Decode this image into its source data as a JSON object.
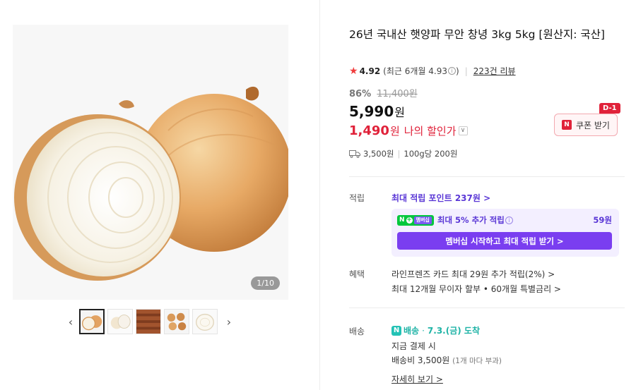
{
  "gallery": {
    "counter": "1/10",
    "prev_icon": "chevron-left-icon",
    "next_icon": "chevron-right-icon"
  },
  "product": {
    "title": "26년 국내산 햇양파 무안 창녕 3kg 5kg [원산지: 국산]",
    "rating": "4.92",
    "recent_rating": "(최근 6개월 4.93",
    "recent_rating_end": ")",
    "review_count": "223건 리뷰",
    "discount_rate": "86%",
    "original_price": "11,400원",
    "price": "5,990",
    "price_unit": "원",
    "my_price": "1,490",
    "my_price_unit": "원",
    "my_price_label": "나의 할인가"
  },
  "coupon": {
    "label": "쿠폰 받기",
    "dday": "D-1",
    "n_letter": "N"
  },
  "shipping_summary": {
    "fee": "3,500원",
    "unit_price": "100g당 200원"
  },
  "points": {
    "label": "적립",
    "link": "최대 적립 포인트 237원 >",
    "member_badge": "멤버십",
    "member_text": "최대 5% 추가 적립",
    "member_value": "59원",
    "member_cta": "멤버십 시작하고 최대 적립 받기 >"
  },
  "benefits": {
    "label": "혜택",
    "line1": "라인프렌즈 카드 최대 29원 추가 적립(2%) >",
    "line2": "최대 12개월 무이자 할부 • 60개월 특별금리 >"
  },
  "delivery": {
    "label": "배송",
    "brand": "배송",
    "arrival": "7.3.(금) 도착",
    "line1": "지금 결제 시",
    "fee_text": "배송비 3,500원",
    "fee_note": "(1개 마다 부과)",
    "detail_link": "자세히 보기 >"
  },
  "colors": {
    "accent_red": "#e0223a",
    "purple": "#7a3ef0",
    "teal": "#1eb3a6",
    "green": "#00c73c"
  }
}
